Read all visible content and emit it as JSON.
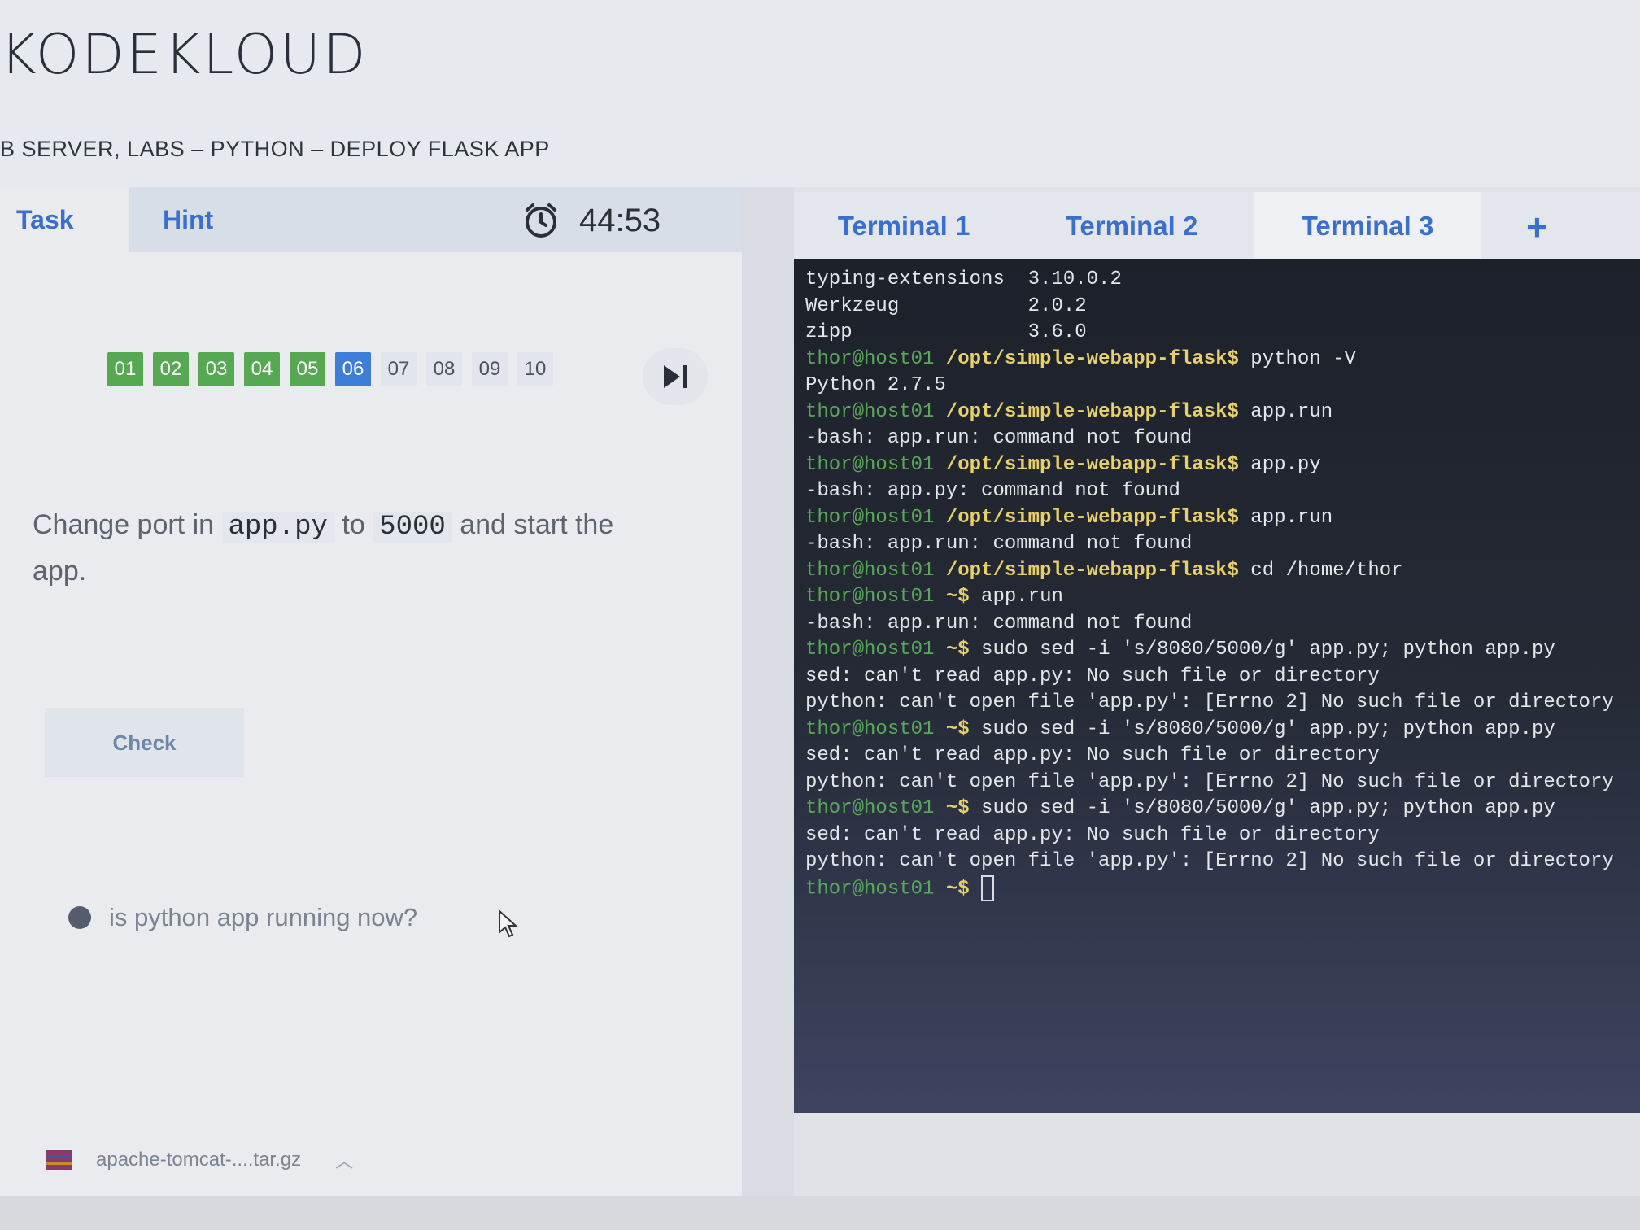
{
  "logo": {
    "text": "KODEKLOUD"
  },
  "breadcrumb": "B SERVER, LABS – PYTHON – DEPLOY FLASK APP",
  "left": {
    "tab_task": "Task",
    "tab_hint": "Hint",
    "timer": "44:53",
    "questions": [
      "01",
      "02",
      "03",
      "04",
      "05",
      "06",
      "07",
      "08",
      "09",
      "10"
    ],
    "done_count": 5,
    "active_index": 5,
    "task_prefix": "Change port in ",
    "task_code_file": "app.py",
    "task_mid": " to ",
    "task_code_port": "5000",
    "task_suffix": " and start the app.",
    "check_label": "Check",
    "question_text": "is python app running now?",
    "download_file": "apache-tomcat-....tar.gz"
  },
  "terminal": {
    "tabs": [
      "Terminal 1",
      "Terminal 2",
      "Terminal 3"
    ],
    "active_tab": 2,
    "add_label": "+",
    "lines": [
      {
        "text": "typing-extensions  3.10.0.2"
      },
      {
        "text": "Werkzeug           2.0.2"
      },
      {
        "text": "zipp               3.6.0"
      },
      {
        "user": "thor@host01",
        "path": "/opt/simple-webapp-flask$",
        "cmd": " python -V"
      },
      {
        "text": "Python 2.7.5"
      },
      {
        "user": "thor@host01",
        "path": "/opt/simple-webapp-flask$",
        "cmd": " app.run"
      },
      {
        "text": "-bash: app.run: command not found"
      },
      {
        "user": "thor@host01",
        "path": "/opt/simple-webapp-flask$",
        "cmd": " app.py"
      },
      {
        "text": "-bash: app.py: command not found"
      },
      {
        "user": "thor@host01",
        "path": "/opt/simple-webapp-flask$",
        "cmd": " app.run"
      },
      {
        "text": "-bash: app.run: command not found"
      },
      {
        "user": "thor@host01",
        "path": "/opt/simple-webapp-flask$",
        "cmd": " cd /home/thor"
      },
      {
        "user": "thor@host01",
        "path": "~$",
        "cmd": " app.run"
      },
      {
        "text": "-bash: app.run: command not found"
      },
      {
        "user": "thor@host01",
        "path": "~$",
        "cmd": " sudo sed -i 's/8080/5000/g' app.py; python app.py"
      },
      {
        "text": "sed: can't read app.py: No such file or directory"
      },
      {
        "text": "python: can't open file 'app.py': [Errno 2] No such file or directory"
      },
      {
        "user": "thor@host01",
        "path": "~$",
        "cmd": " sudo sed -i 's/8080/5000/g' app.py; python app.py"
      },
      {
        "text": "sed: can't read app.py: No such file or directory"
      },
      {
        "text": "python: can't open file 'app.py': [Errno 2] No such file or directory"
      },
      {
        "user": "thor@host01",
        "path": "~$",
        "cmd": " sudo sed -i 's/8080/5000/g' app.py; python app.py"
      },
      {
        "text": "sed: can't read app.py: No such file or directory"
      },
      {
        "text": "python: can't open file 'app.py': [Errno 2] No such file or directory"
      },
      {
        "user": "thor@host01",
        "path": "~$",
        "cmd": " ",
        "cursor": true
      }
    ]
  },
  "colors": {
    "accent": "#3b6fcf",
    "done": "#57a852",
    "active": "#3d7ed8",
    "prompt_user": "#59a85a",
    "prompt_path": "#e8d069"
  },
  "icons": [
    "alarm-clock-icon",
    "skip-next-icon",
    "archive-file-icon",
    "chevron-up-icon",
    "mouse-pointer-icon"
  ]
}
